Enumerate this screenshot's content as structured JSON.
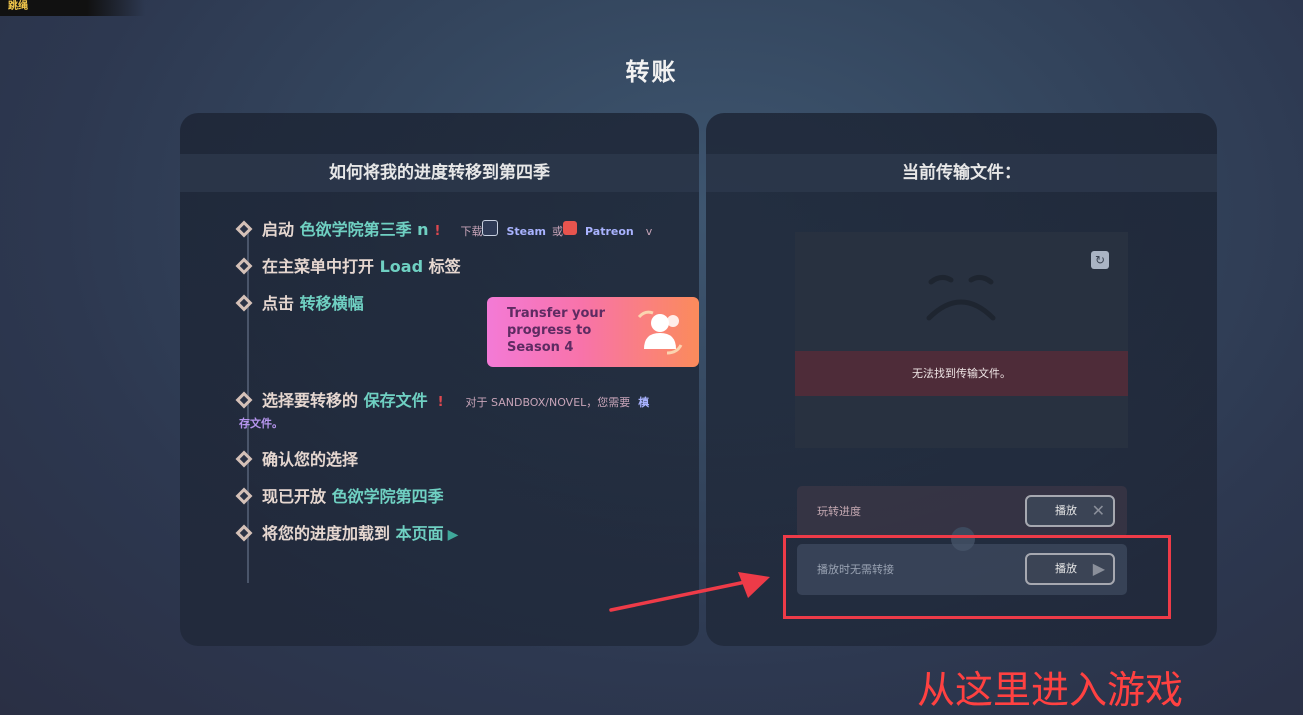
{
  "corner_tag": "跳绳",
  "page_title": "转账",
  "left_panel": {
    "header": "如何将我的进度转移到第四季",
    "steps": [
      {
        "prefix": "启动 ",
        "highlight": "色欲学院第三季 n",
        "suffix": "!",
        "note": "下载",
        "link1": "Steam",
        "or": "或",
        "link2": "Patreon",
        "tail": "v"
      },
      {
        "prefix": "在主菜单中打开 ",
        "highlight": "Load",
        "suffix": " 标签"
      },
      {
        "prefix": "点击 ",
        "highlight": "转移横幅"
      },
      {
        "prefix": "选择要转移的 ",
        "highlight": "保存文件",
        "suffix": "!",
        "note": "对于 SANDBOX/NOVEL，您需要",
        "tail": "槙"
      },
      {
        "prefix": "确认您的选择"
      },
      {
        "prefix": "现已开放 ",
        "highlight": "色欲学院第四季"
      },
      {
        "prefix": "将您的进度加载到 ",
        "highlight": "本页面"
      }
    ],
    "step4_sub": "存文件。",
    "banner_lines": [
      "Transfer your",
      "progress to",
      "Season 4"
    ]
  },
  "right_panel": {
    "header": "当前传输文件：",
    "error_text": "无法找到传输文件。",
    "options": [
      {
        "label": "玩转进度",
        "button": "播放",
        "icon": "close-icon"
      },
      {
        "label": "播放时无需转接",
        "button": "播放",
        "icon": "play-icon"
      }
    ]
  },
  "annotation": {
    "caption": "从这里进入游戏",
    "color": "#ee3b48"
  }
}
